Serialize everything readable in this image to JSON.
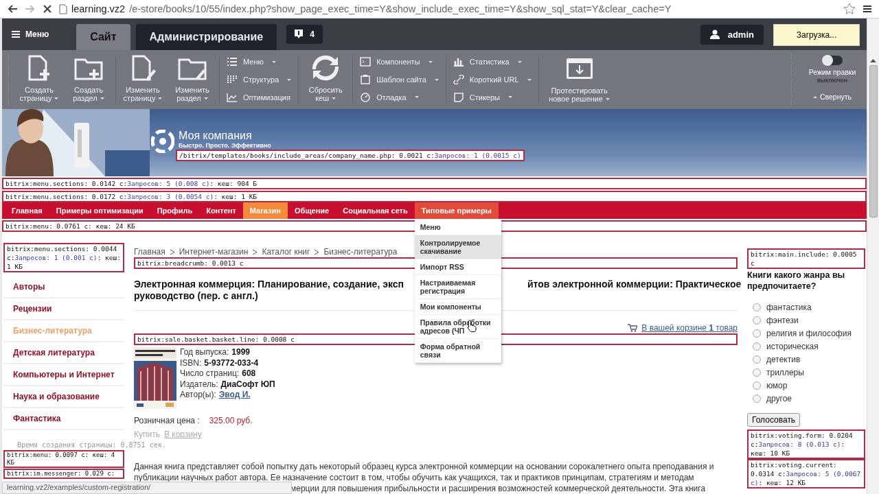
{
  "browser": {
    "host": "learning.vz2",
    "path": "/e-store/books/10/55/index.php?show_page_exec_time=Y&show_include_exec_time=Y&show_sql_stat=Y&clear_cache=Y"
  },
  "admin": {
    "menu": "Меню",
    "tabs": [
      {
        "label": "Сайт",
        "selected": true
      },
      {
        "label": "Администрирование",
        "selected": false
      }
    ],
    "notifications": "4",
    "user": "admin",
    "loading": "Загрузка..."
  },
  "toolbar": {
    "groups": [
      {
        "kind": "big",
        "buttons": [
          {
            "lines": [
              "Создать",
              "страницу"
            ],
            "has_menu": true
          },
          {
            "lines": [
              "Создать",
              "раздел"
            ],
            "has_menu": true
          }
        ]
      },
      {
        "kind": "big",
        "buttons": [
          {
            "lines": [
              "Изменить",
              "страницу"
            ],
            "has_menu": true
          },
          {
            "lines": [
              "Изменить",
              "раздел"
            ],
            "has_menu": true
          }
        ]
      },
      {
        "kind": "list",
        "items": [
          {
            "label": "Меню",
            "has_menu": true
          },
          {
            "label": "Структура",
            "has_menu": true
          },
          {
            "label": "Оптимизация",
            "has_menu": false
          }
        ]
      },
      {
        "kind": "big",
        "buttons": [
          {
            "lines": [
              "Сбросить",
              "кеш"
            ],
            "has_menu": true
          }
        ]
      },
      {
        "kind": "list",
        "items": [
          {
            "label": "Компоненты",
            "has_menu": true
          },
          {
            "label": "Шаблон сайта",
            "has_menu": true
          },
          {
            "label": "Отладка",
            "has_menu": true
          }
        ]
      },
      {
        "kind": "list",
        "items": [
          {
            "label": "Статистика",
            "has_menu": true
          },
          {
            "label": "Короткий URL",
            "has_menu": true
          },
          {
            "label": "Стикеры",
            "has_menu": true
          }
        ]
      },
      {
        "kind": "big",
        "buttons": [
          {
            "lines": [
              "Протестировать",
              "новое решение"
            ],
            "has_menu": true
          }
        ]
      }
    ],
    "edit_mode": {
      "label": "Режим правки",
      "state": "выключен",
      "on": false
    },
    "collapse": "Свернуть"
  },
  "header": {
    "company": "Моя компания",
    "slogan": "Быстро. Просто. Эффективно",
    "include_debug": {
      "label": "/bitrix/templates/books/include_areas/company_name.php: 0.0021 с:",
      "queries": "Запросов: 1 (0.0015 с)"
    }
  },
  "debug_rows": [
    {
      "label": "bitrix:menu.sections: 0.0142 с:",
      "queries": "Запросов: 5 (0.008 с)",
      "rest": ": кеш: 904 Б"
    },
    {
      "label": "bitrix:menu.sections: 0.0172 с:",
      "queries": "Запросов: 3 (0.0054 с)",
      "rest": ": кеш: 1 КБ"
    }
  ],
  "nav": {
    "items": [
      {
        "label": "Главная",
        "selected": false,
        "expanded": false
      },
      {
        "label": "Примеры оптимизации",
        "selected": false,
        "expanded": false
      },
      {
        "label": "Профиль",
        "selected": false,
        "expanded": false
      },
      {
        "label": "Контент",
        "selected": false,
        "expanded": false
      },
      {
        "label": "Магазин",
        "selected": true,
        "expanded": false
      },
      {
        "label": "Общение",
        "selected": false,
        "expanded": false
      },
      {
        "label": "Социальная сеть",
        "selected": false,
        "expanded": false
      },
      {
        "label": "Типовые примеры",
        "selected": false,
        "expanded": true
      }
    ],
    "debug": {
      "label": "bitrix:menu: 0.0761 с: кеш: 24 КБ"
    },
    "dropdown": [
      {
        "label": "Меню",
        "selected": false
      },
      {
        "label": "Контролируемое скачивание",
        "selected": true
      },
      {
        "label": "Импорт RSS",
        "selected": false
      },
      {
        "label": "Настраиваемая регистрация",
        "selected": false
      },
      {
        "label": "Мои компоненты",
        "selected": false
      },
      {
        "label": "Правила обработки адресов (ЧП",
        "selected": false
      },
      {
        "label": "Форма обратной связи",
        "selected": false
      }
    ]
  },
  "left": {
    "debug": {
      "label": "bitrix:menu.sections: 0.0044 с:",
      "queries": "Запросов: 1 (0.001 с)",
      "rest": ": кеш: 1 КБ"
    },
    "items": [
      {
        "label": "Авторы",
        "selected": false
      },
      {
        "label": "Рецензии",
        "selected": false
      },
      {
        "label": "Бизнес-литература",
        "selected": true
      },
      {
        "label": "Детская литература",
        "selected": false
      },
      {
        "label": "Компьютеры и Интернет",
        "selected": false
      },
      {
        "label": "Наука и образование",
        "selected": false
      },
      {
        "label": "Фантастика",
        "selected": false
      }
    ],
    "stats": "Время создания страницы: 0.8751 сек.",
    "bottom_debug": [
      {
        "label": "bitrix:menu: 0.0097 с: кеш: 4 КБ"
      },
      {
        "label": "bitrix:im.messenger: 0.029 с:"
      }
    ]
  },
  "content": {
    "breadcrumb": [
      "Главная",
      "Интернет-магазин",
      "Каталог книг",
      "Бизнес-литература"
    ],
    "breadcrumb_debug": {
      "label": "bitrix:breadcrumb: 0.0013 с"
    },
    "title_left": "Электронная коммерция: Планирование, создание, эксп",
    "title_right": "йтов электронной коммерции: Практическое",
    "title_line2": "руководство (пер. с англ.)",
    "cart": "В вашей корзине **1** товар",
    "basket_debug": {
      "label": "bitrix:sale.basket.basket.line: 0.0008 с"
    },
    "details": [
      {
        "label": "Год выпуска:",
        "value": "1999",
        "kind": "text"
      },
      {
        "label": "ISBN:",
        "value": "5-93772-033-4",
        "kind": "text"
      },
      {
        "label": "Число страниц:",
        "value": "608",
        "kind": "text"
      },
      {
        "label": "Издатель:",
        "value": "ДиаСофт ЮП",
        "kind": "text"
      },
      {
        "label": "Автор(ы):",
        "value": "Эвод И.",
        "kind": "link"
      }
    ],
    "price_label": "Розничная цена  :",
    "price": "325.00 руб.",
    "buy": "Купить",
    "add_to_cart": "В корзину",
    "paragraph": "Данная книга представляет собой попытку дать некоторый образец курса электронной коммерции на основании сорокалетнего опыта преподавания и публикации научных работ автора. Ее назначение состоит в том, чтобы обучить как учащихся, так и практиков принципам, стратегиям и методам",
    "paragraph_tail": "мерции для повышения прибыльности и расширения возможностей коммерческой деятельности. Эта книга"
  },
  "right": {
    "debug": {
      "label": "bitrix:main.include: 0.0005 с"
    },
    "question": "Книги какого жанра вы предпочитаете?",
    "options": [
      {
        "label": "фантастика",
        "selected": false
      },
      {
        "label": "фэнтези",
        "selected": false
      },
      {
        "label": "религия и философия",
        "selected": false
      },
      {
        "label": "историческая",
        "selected": false
      },
      {
        "label": "детектив",
        "selected": false
      },
      {
        "label": "триллеры",
        "selected": false
      },
      {
        "label": "юмор",
        "selected": false
      },
      {
        "label": "другое",
        "selected": false
      }
    ],
    "vote": "Голосовать",
    "debug2": [
      {
        "label": "bitrix:voting.form: 0.0204 с:",
        "queries": "Запросов: 8 (0.013 с)",
        "rest": ": кеш: 10 КБ"
      },
      {
        "label": "bitrix:voting.current: 0.0314 с:",
        "queries": "Запросов: 5 (0.0067 с)",
        "rest": ": кеш: 12 КБ"
      }
    ]
  },
  "status_url": "learning.vz2/examples/custom-registration/"
}
